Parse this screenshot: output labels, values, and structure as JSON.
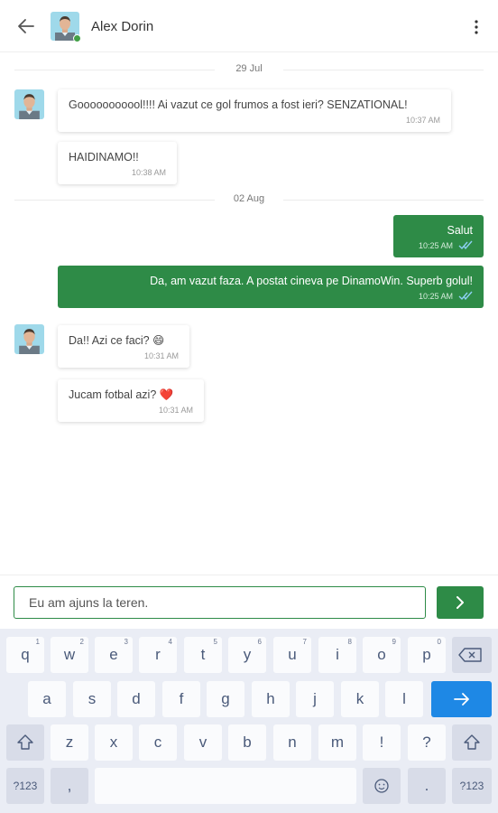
{
  "header": {
    "contact_name": "Alex Dorin",
    "back_icon": "arrow-left-icon",
    "menu_icon": "more-vert-icon",
    "online_color": "#43a047"
  },
  "conversation": {
    "dates": [
      "29 Jul",
      "02 Aug"
    ],
    "messages": [
      {
        "direction": "in",
        "text": "Gooooooooool!!!! Ai vazut ce gol frumos a fost ieri? SENZATIONAL!",
        "time": "10:37 AM"
      },
      {
        "direction": "in",
        "text": "HAIDINAMO!!",
        "time": "10:38 AM"
      },
      {
        "direction": "out",
        "text": "Salut",
        "time": "10:25 AM",
        "status": "read"
      },
      {
        "direction": "out",
        "text": "Da, am vazut faza. A postat cineva pe DinamoWin. Superb golul!",
        "time": "10:25 AM",
        "status": "read"
      },
      {
        "direction": "in",
        "text": "Da!! Azi ce faci? 😄",
        "time": "10:31 AM"
      },
      {
        "direction": "in",
        "text": "Jucam fotbal azi? ❤️",
        "time": "10:31 AM"
      }
    ]
  },
  "composer": {
    "value": "Eu am ajuns la teren.",
    "send_icon": "chevron-right-icon"
  },
  "keyboard": {
    "row1": [
      {
        "key": "q",
        "hint": "1"
      },
      {
        "key": "w",
        "hint": "2"
      },
      {
        "key": "e",
        "hint": "3"
      },
      {
        "key": "r",
        "hint": "4"
      },
      {
        "key": "t",
        "hint": "5"
      },
      {
        "key": "y",
        "hint": "6"
      },
      {
        "key": "u",
        "hint": "7"
      },
      {
        "key": "i",
        "hint": "8"
      },
      {
        "key": "o",
        "hint": "9"
      },
      {
        "key": "p",
        "hint": "0"
      }
    ],
    "row2": [
      "a",
      "s",
      "d",
      "f",
      "g",
      "h",
      "j",
      "k",
      "l"
    ],
    "row3": [
      "z",
      "x",
      "c",
      "v",
      "b",
      "n",
      "m",
      "!",
      "?"
    ],
    "symbols_label": "?123",
    "comma": ",",
    "period": ".",
    "backspace_icon": "backspace-icon",
    "enter_icon": "arrow-right-icon",
    "shift_icon": "shift-icon",
    "emoji_icon": "emoji-icon"
  },
  "colors": {
    "accent": "#2e8b47",
    "enter_key": "#1e88e5",
    "keyboard_bg": "#eaedf5"
  }
}
